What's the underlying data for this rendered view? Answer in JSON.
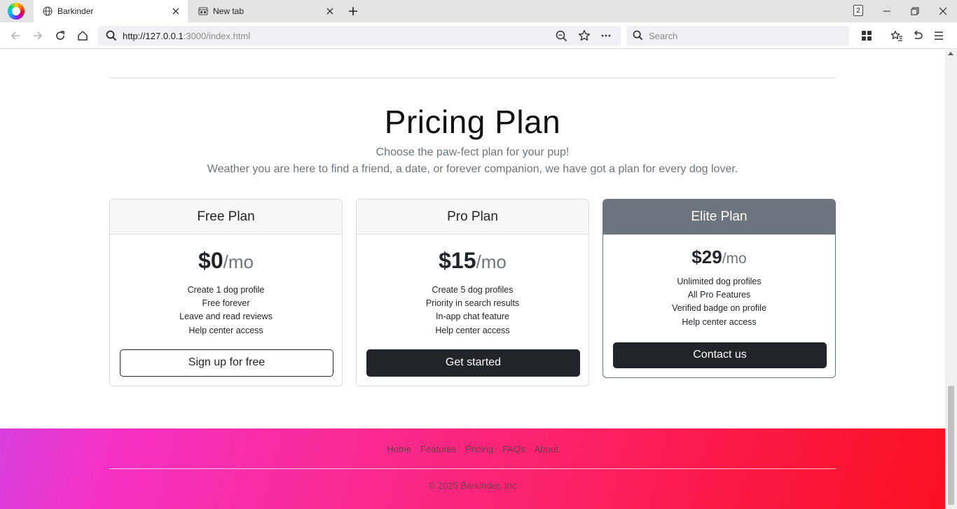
{
  "browser": {
    "tabs": [
      {
        "title": "Barkinder",
        "icon": "globe-icon"
      },
      {
        "title": "New tab",
        "icon": "newtab-icon"
      }
    ],
    "tab_count": "2",
    "url_host": "http://127.0.0.1",
    "url_rest": ":3000/index.html",
    "search_placeholder": "Search"
  },
  "page": {
    "title": "Pricing Plan",
    "subtitle_1": "Choose the paw-fect plan for your pup!",
    "subtitle_2": "Weather you are here to find a friend, a date, or forever companion, we have got a plan for every dog lover.",
    "plans": [
      {
        "name": "Free Plan",
        "price": "$0",
        "per": "/mo",
        "features": [
          "Create 1 dog profile",
          "Free forever",
          "Leave and read reviews",
          "Help center access"
        ],
        "cta": "Sign up for free"
      },
      {
        "name": "Pro Plan",
        "price": "$15",
        "per": "/mo",
        "features": [
          "Create 5 dog profiles",
          "Priority in search results",
          "In-app chat feature",
          "Help center access"
        ],
        "cta": "Get started"
      },
      {
        "name": "Elite Plan",
        "price": "$29",
        "per": "/mo",
        "features": [
          "Unlimited dog profiles",
          "All Pro Features",
          "Verified badge on profile",
          "Help center access"
        ],
        "cta": "Contact us"
      }
    ]
  },
  "footer": {
    "links": [
      "Home",
      "Features",
      "Pricing",
      "FAQs",
      "About"
    ],
    "copyright": "© 2025 Barkinder, Inc"
  },
  "colors": {
    "elite_header": "#6c757d",
    "dark_button": "#212529",
    "footer_gradient_start": "#d83fdc",
    "footer_gradient_end": "#fa1020"
  }
}
